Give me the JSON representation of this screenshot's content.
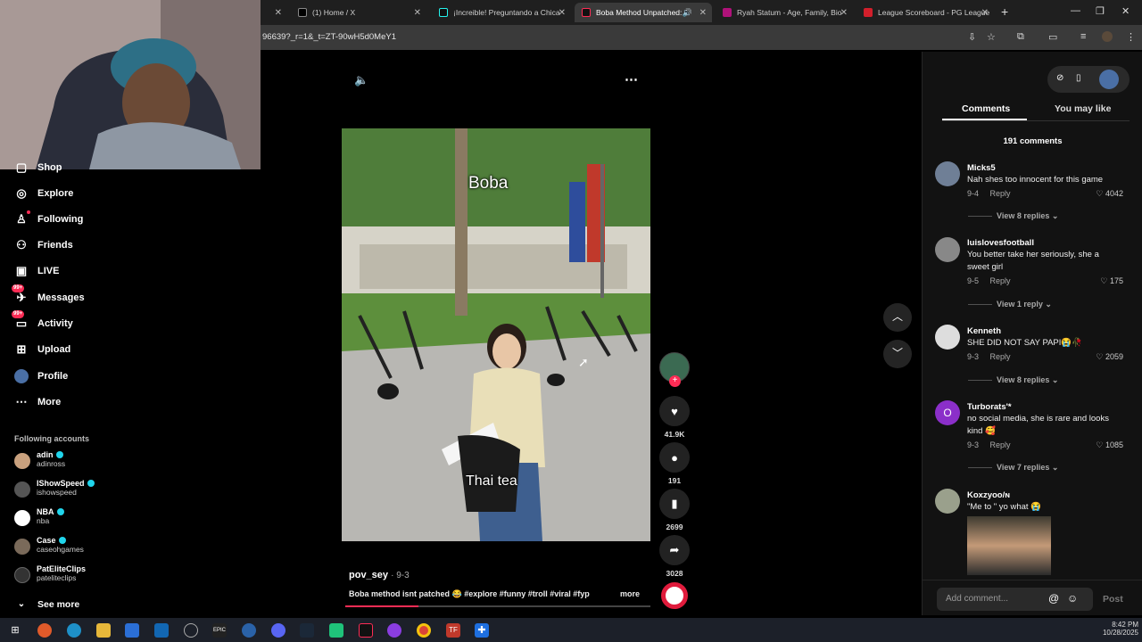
{
  "browser": {
    "tabs": [
      {
        "title": "(1) Home / X",
        "active": false
      },
      {
        "title": "¡Increible! Preguntando a Chica",
        "active": false
      },
      {
        "title": "Boba Method Unpatched: A",
        "active": true
      },
      {
        "title": "Ryah Statum - Age, Family, Bio",
        "active": false
      },
      {
        "title": "League Scoreboard - PG League",
        "active": false
      }
    ],
    "url": "96639?_r=1&_t=ZT-90wH5d0MeY1"
  },
  "sidebar": {
    "items": [
      {
        "label": "Shop",
        "icon": "shop-icon"
      },
      {
        "label": "Explore",
        "icon": "compass-icon"
      },
      {
        "label": "Following",
        "icon": "following-icon"
      },
      {
        "label": "Friends",
        "icon": "friends-icon"
      },
      {
        "label": "LIVE",
        "icon": "live-icon"
      },
      {
        "label": "Messages",
        "icon": "messages-icon",
        "badge": "99+"
      },
      {
        "label": "Activity",
        "icon": "activity-icon",
        "badge": "99+"
      },
      {
        "label": "Upload",
        "icon": "upload-icon"
      },
      {
        "label": "Profile",
        "icon": "profile-icon"
      },
      {
        "label": "More",
        "icon": "more-icon"
      }
    ],
    "following_title": "Following accounts",
    "accounts": [
      {
        "name": "adin",
        "handle": "adinross",
        "verified": true
      },
      {
        "name": "IShowSpeed",
        "handle": "ishowspeed",
        "verified": true
      },
      {
        "name": "NBA",
        "handle": "nba",
        "verified": true
      },
      {
        "name": "Case",
        "handle": "caseohgames",
        "verified": true
      },
      {
        "name": "PatEliteClips",
        "handle": "pateliteclips",
        "verified": false
      }
    ],
    "see_more": "See more"
  },
  "video": {
    "caption_top": "Boba",
    "caption_bottom": "Thai tea",
    "author": "pov_sey",
    "date": "· 9-3",
    "description": "Boba method isnt patched 😂 #explore #funny #troll #viral #fyp",
    "more": "more",
    "likes": "41.9K",
    "comments": "191",
    "saves": "2699",
    "shares": "3028"
  },
  "comments_panel": {
    "tabs": [
      "Comments",
      "You may like"
    ],
    "count_label": "191 comments",
    "comments": [
      {
        "user": "Micks5",
        "text": "Nah shes too innocent for this game",
        "date": "9-4",
        "reply": "Reply",
        "likes": "4042",
        "replies": "View 8 replies"
      },
      {
        "user": "luislovesfootball",
        "text": "You better take her seriously, she a sweet girl",
        "date": "9-5",
        "reply": "Reply",
        "likes": "175",
        "replies": "View 1 reply"
      },
      {
        "user": "Kenneth",
        "text": "SHE DID NOT SAY PAPI😭🥀",
        "date": "9-3",
        "reply": "Reply",
        "likes": "2059",
        "replies": "View 8 replies"
      },
      {
        "user": "Turborats'*",
        "text": "no social media, she is rare and looks kind 🥰",
        "date": "9-3",
        "reply": "Reply",
        "likes": "1085",
        "replies": "View 7 replies",
        "avatar_letter": "O"
      },
      {
        "user": "Koxzyoo/ɴ",
        "text": "\"Me to \" yo what 😭",
        "date": "",
        "reply": "",
        "likes": "",
        "replies": ""
      }
    ],
    "add_placeholder": "Add comment...",
    "post": "Post"
  },
  "taskbar": {
    "time": "8:42 PM",
    "date": "10/28/2025"
  },
  "colors": {
    "accent": "#fe2c55",
    "verified": "#20d5ec",
    "panel_bg": "#121212"
  }
}
